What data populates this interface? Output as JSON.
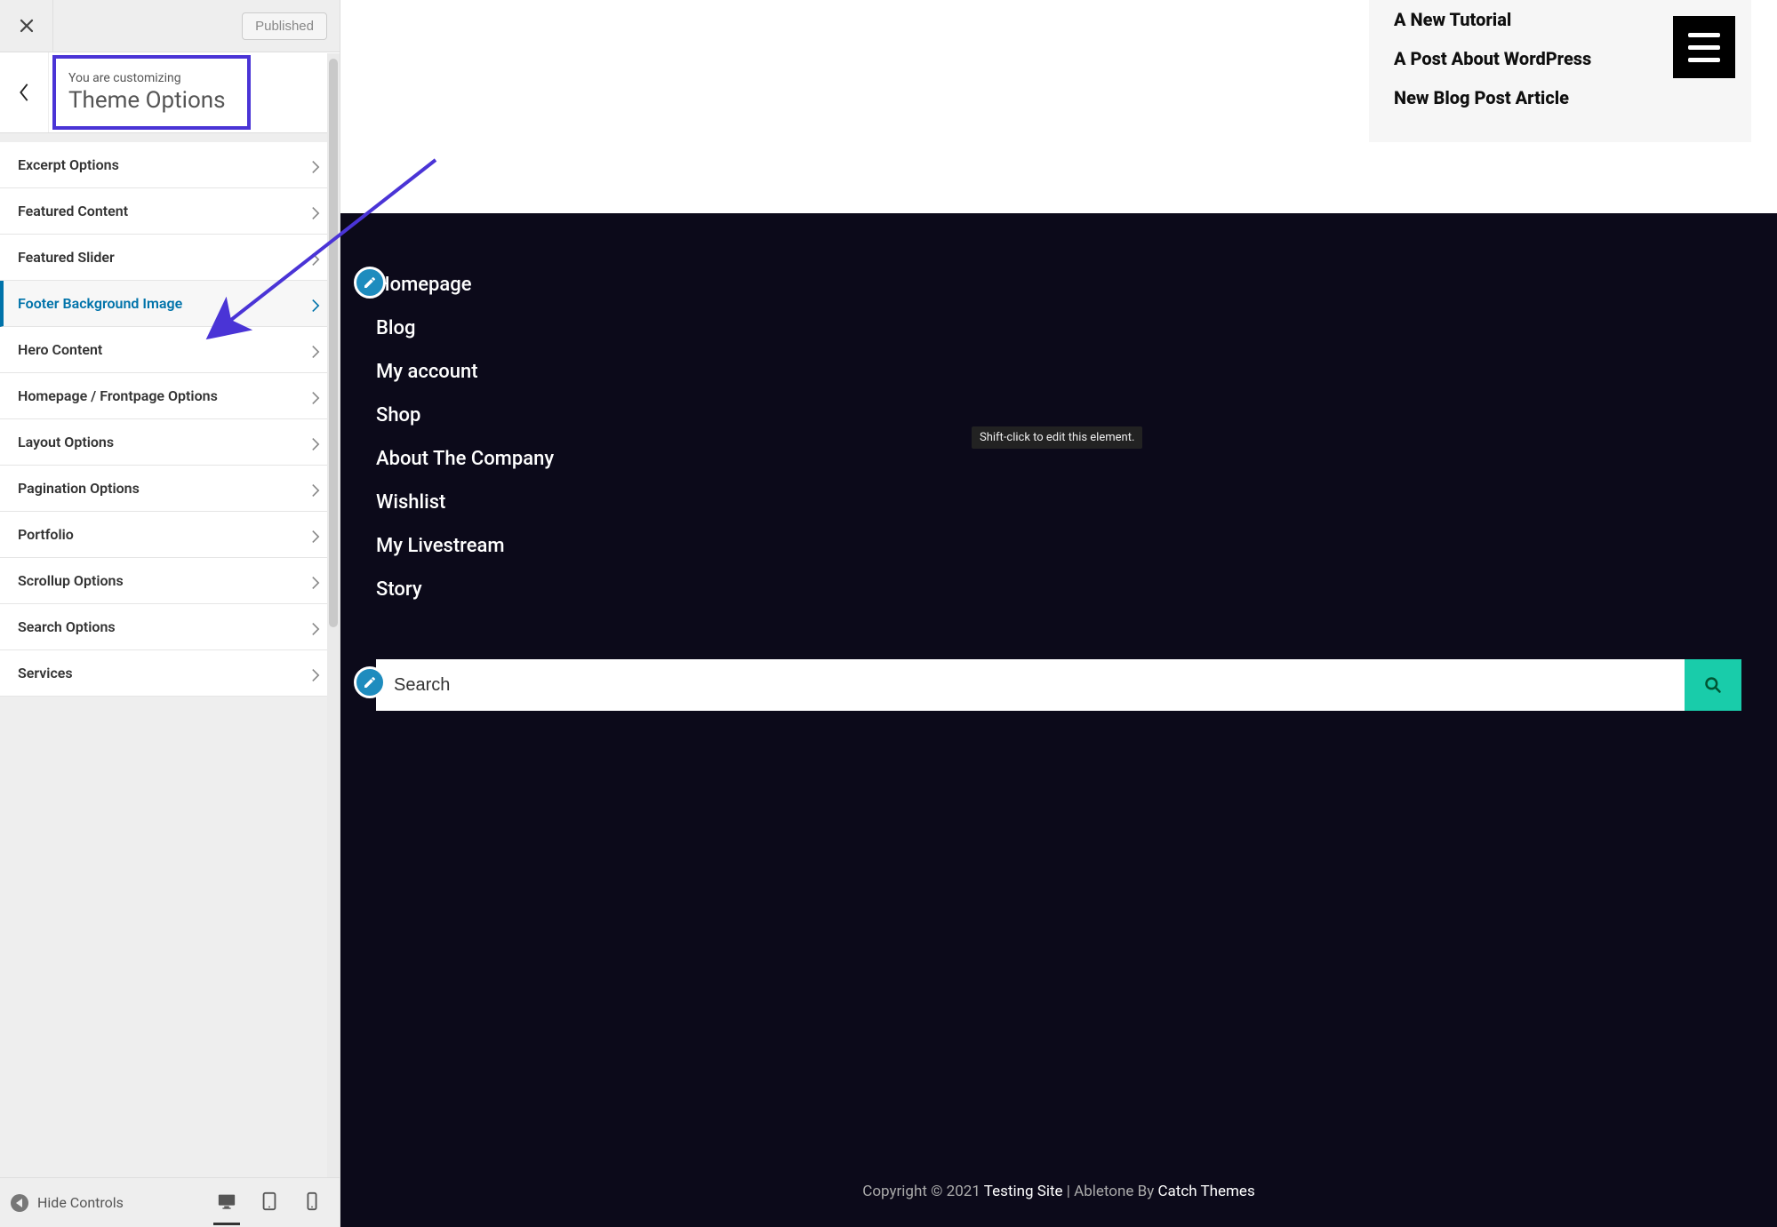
{
  "sidebar": {
    "published_label": "Published",
    "header_sub": "You are customizing",
    "header_title": "Theme Options",
    "options": [
      {
        "label": "Excerpt Options",
        "active": false
      },
      {
        "label": "Featured Content",
        "active": false
      },
      {
        "label": "Featured Slider",
        "active": false
      },
      {
        "label": "Footer Background Image",
        "active": true
      },
      {
        "label": "Hero Content",
        "active": false
      },
      {
        "label": "Homepage / Frontpage Options",
        "active": false
      },
      {
        "label": "Layout Options",
        "active": false
      },
      {
        "label": "Pagination Options",
        "active": false
      },
      {
        "label": "Portfolio",
        "active": false
      },
      {
        "label": "Scrollup Options",
        "active": false
      },
      {
        "label": "Search Options",
        "active": false
      },
      {
        "label": "Services",
        "active": false
      }
    ],
    "hide_controls_label": "Hide Controls"
  },
  "preview": {
    "recent_posts": [
      "A New Tutorial",
      "A Post About WordPress",
      "New Blog Post Article"
    ],
    "footer_nav": [
      "Homepage",
      "Blog",
      "My account",
      "Shop",
      "About The Company",
      "Wishlist",
      "My Livestream",
      "Story"
    ],
    "tooltip": "Shift-click to edit this element.",
    "search_placeholder": "Search",
    "copyright_prefix": "Copyright © 2021 ",
    "copyright_site": "Testing Site",
    "copyright_mid": " | Abletone By ",
    "copyright_theme": "Catch Themes"
  }
}
